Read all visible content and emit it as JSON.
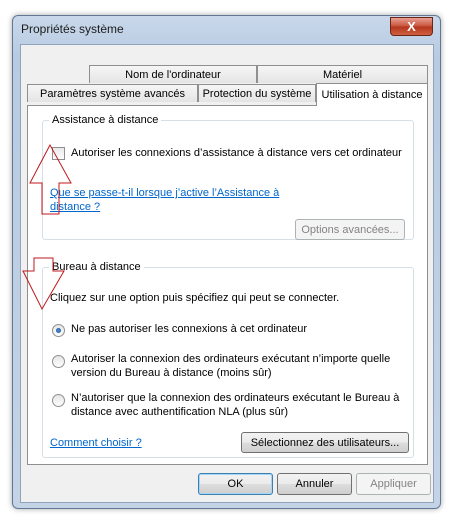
{
  "window": {
    "title": "Propriétés système",
    "close_label": "X"
  },
  "tabs": {
    "row1": [
      "Nom de l'ordinateur",
      "Matériel"
    ],
    "row2": [
      "Paramètres système avancés",
      "Protection du système",
      "Utilisation à distance"
    ],
    "active": "Utilisation à distance"
  },
  "assistance": {
    "legend": "Assistance à distance",
    "checkbox_label": "Autoriser les connexions d’assistance à distance vers cet ordinateur",
    "checkbox_checked": false,
    "help_link_line1": "Que se passe-t-il lorsque j’active l’Assistance à",
    "help_link_line2": "distance ?",
    "advanced_button": "Options avancées..."
  },
  "bureau": {
    "legend": "Bureau à distance",
    "instruction": "Cliquez sur une option puis spécifiez qui peut se connecter.",
    "options": [
      {
        "line1": "Ne pas autoriser les connexions à cet ordinateur",
        "line2": "",
        "checked": true
      },
      {
        "line1": "Autoriser la connexion des ordinateurs exécutant n’importe quelle",
        "line2": "version du Bureau à distance (moins sûr)",
        "checked": false
      },
      {
        "line1": "N’autoriser que la connexion des ordinateurs exécutant le Bureau à",
        "line2": "distance avec authentification NLA (plus sûr)",
        "checked": false
      }
    ],
    "choose_link": "Comment choisir ?",
    "select_users_button": "Sélectionnez des utilisateurs..."
  },
  "footer": {
    "ok": "OK",
    "cancel": "Annuler",
    "apply": "Appliquer"
  },
  "colors": {
    "annotation_arrow": "#c0171b",
    "link": "#0066cc"
  }
}
